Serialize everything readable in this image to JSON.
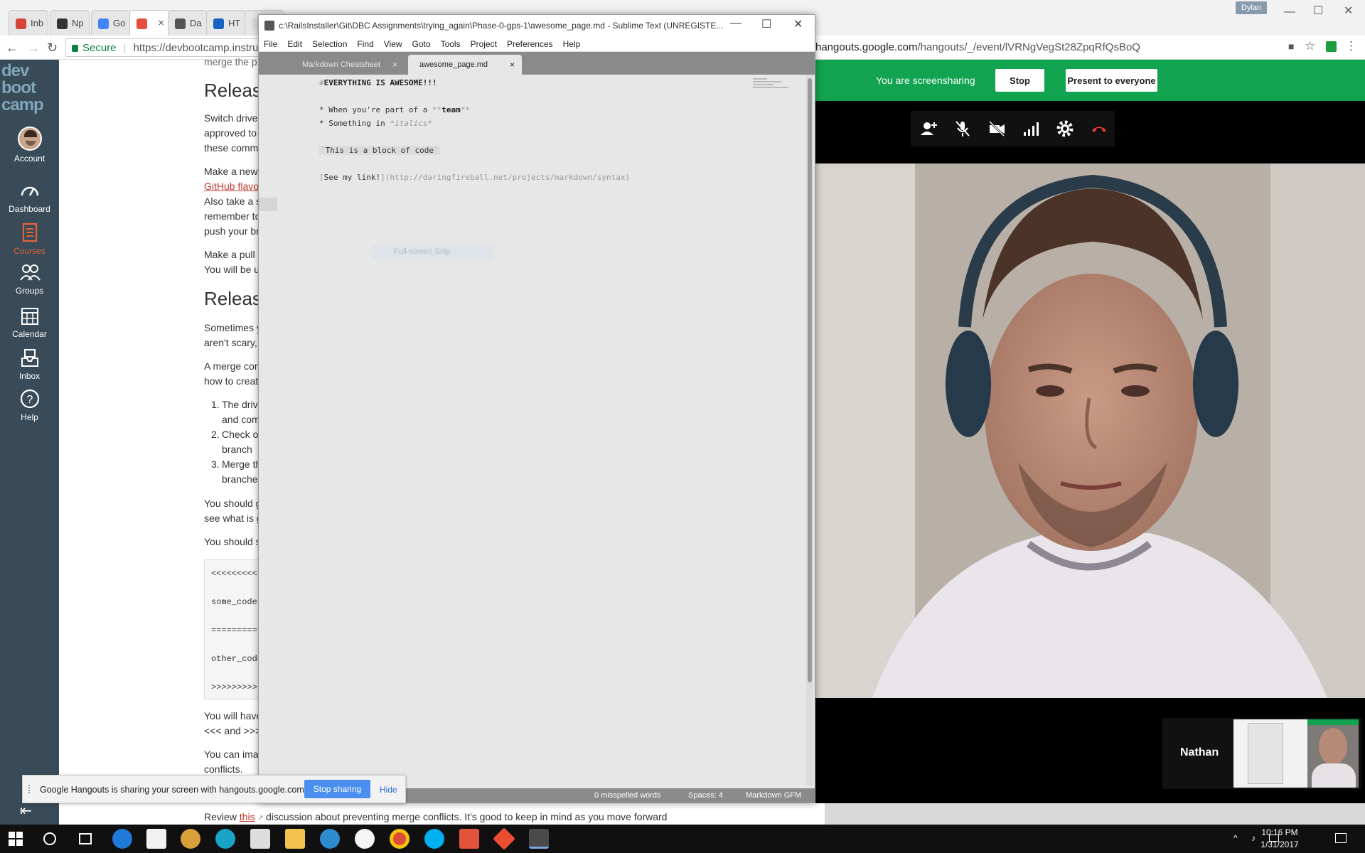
{
  "chrome_left": {
    "tabs": [
      {
        "label": "Inb",
        "color": "#d44638"
      },
      {
        "label": "Np",
        "color": "#333333"
      },
      {
        "label": "Go",
        "color": "#4285f4"
      },
      {
        "label": "",
        "color": "#e74c3c"
      },
      {
        "label": "Da",
        "color": "#555555"
      },
      {
        "label": "HT",
        "color": "#1565c0"
      },
      {
        "label": "",
        "color": "#dddddd"
      }
    ],
    "security_label": "Secure",
    "url": "https://devbootcamp.instructure.com"
  },
  "lms": {
    "logo": [
      "dev",
      "boot",
      "camp"
    ],
    "nav": [
      {
        "label": "Account",
        "icon": "avatar"
      },
      {
        "label": "Dashboard",
        "icon": "dashboard-icon"
      },
      {
        "label": "Courses",
        "icon": "courses-icon"
      },
      {
        "label": "Groups",
        "icon": "groups-icon"
      },
      {
        "label": "Calendar",
        "icon": "calendar-icon"
      },
      {
        "label": "Inbox",
        "icon": "inbox-icon"
      },
      {
        "label": "Help",
        "icon": "help-icon"
      }
    ],
    "content": {
      "top_line": "merge the p",
      "h1": "Release",
      "p1": [
        "Switch drive",
        "approved to",
        "these comma"
      ],
      "p2": [
        "Make a new",
        "GitHub flavo",
        "Also take a s",
        "remember to",
        "push your br"
      ],
      "p3": [
        "Make a pull r",
        "You will be u"
      ],
      "h2": "Release",
      "p4": [
        "Sometimes y",
        "aren't scary,"
      ],
      "p5": [
        "A merge con",
        "how to creat"
      ],
      "list": [
        {
          "num": "1.",
          "lines": [
            "The drive",
            "and com"
          ]
        },
        {
          "num": "2.",
          "lines": [
            "Check ou",
            "branch"
          ]
        },
        {
          "num": "3.",
          "lines": [
            "Merge th",
            "branches"
          ]
        }
      ],
      "p6": [
        "You should g",
        "see what is g"
      ],
      "p7": "You should s",
      "code": [
        "<<<<<<<<<",
        "some_code",
        "=========",
        "other_code",
        ">>>>>>>>>"
      ],
      "p8": [
        "You will have",
        "<<< and >>>"
      ],
      "p9": [
        "You can imag",
        "conflicts."
      ],
      "review_prefix": "Review",
      "review_link": "this",
      "review_suffix": "discussion about preventing merge conflicts. It's good to keep in mind as you move forward"
    }
  },
  "sublime": {
    "title": "c:\\RailsInstaller\\Git\\DBC Assignments\\trying_again\\Phase-0-gps-1\\awesome_page.md - Sublime Text (UNREGISTE...",
    "menu": [
      "File",
      "Edit",
      "Selection",
      "Find",
      "View",
      "Goto",
      "Tools",
      "Project",
      "Preferences",
      "Help"
    ],
    "tabs": [
      {
        "label": "Markdown Cheatsheet",
        "active": false
      },
      {
        "label": "awesome_page.md",
        "active": true
      }
    ],
    "lines": {
      "l1_hash": "#",
      "l1_text": "EVERYTHING IS AWESOME!!!",
      "l2_bullet": "* When you're part of a ",
      "l2_open": "**",
      "l2_bold": "team",
      "l2_close": "**",
      "l3_bullet": "* Something in ",
      "l3_open": "*",
      "l3_ital": "italics",
      "l3_close": "*",
      "l4_tick": "`",
      "l4_code": "This is a block of code",
      "l5_open": "[",
      "l5_text": "See my link!",
      "l5_url": "](http://daringfireball.net/projects/markdown/syntax)"
    },
    "hint": "Full-screen Snip",
    "status": {
      "spell": "0 misspelled words",
      "spaces": "Spaces: 4",
      "syntax": "Markdown GFM"
    }
  },
  "hangouts": {
    "user_badge": "Dylan",
    "url_host": "hangouts.google.com",
    "url_path": "/hangouts/_/event/lVRNgVegSt28ZpqRfQsBoQ",
    "banner_text": "You are screensharing",
    "stop_label": "Stop",
    "present_label": "Present to everyone",
    "controls": [
      "add-person-icon",
      "mute-mic-icon",
      "camera-off-icon",
      "signal-icon",
      "settings-icon",
      "hang-up-icon"
    ],
    "participant_name": "Nathan",
    "brand_color": "#11a34f"
  },
  "share_notice": {
    "text": "Google Hangouts is sharing your screen with hangouts.google.com.",
    "stop_label": "Stop sharing",
    "hide_label": "Hide"
  },
  "taskbar": {
    "time": "10:16 PM",
    "date": "1/31/2017"
  }
}
